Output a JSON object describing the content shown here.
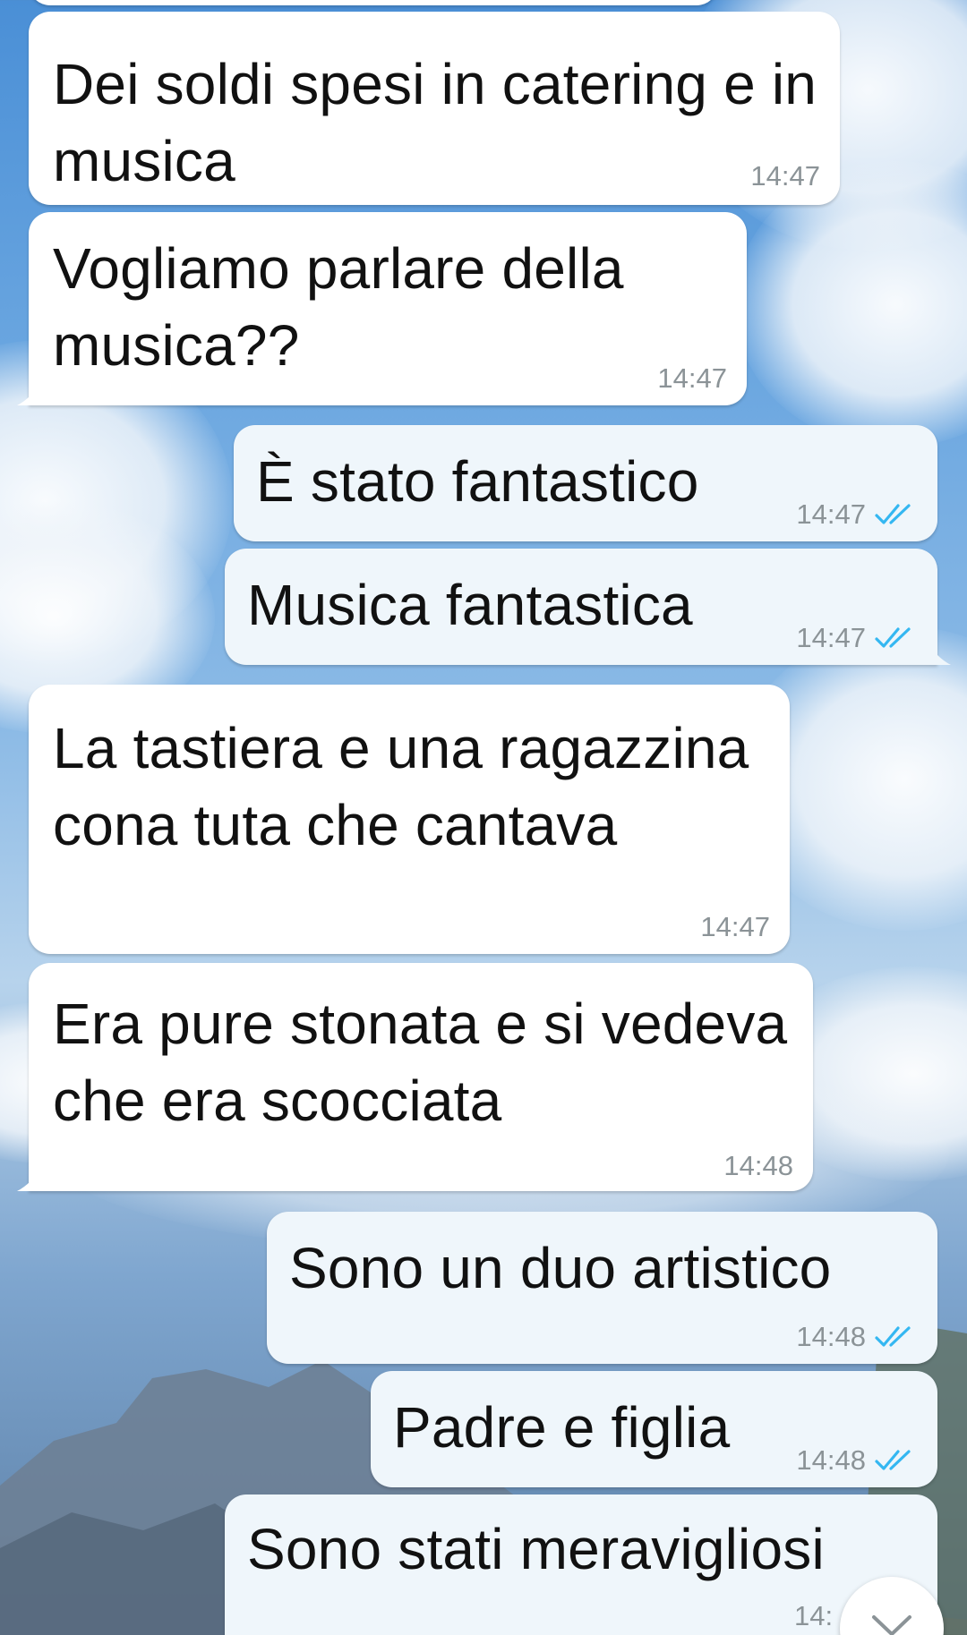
{
  "messages": [
    {
      "direction": "in",
      "text": "Dei soldi spesi in catering e in musica",
      "time": "14:47"
    },
    {
      "direction": "in",
      "text": "Vogliamo parlare della musica??",
      "time": "14:47"
    },
    {
      "direction": "out",
      "text": "È stato fantastico",
      "time": "14:47",
      "status": "read"
    },
    {
      "direction": "out",
      "text": "Musica fantastica",
      "time": "14:47",
      "status": "read"
    },
    {
      "direction": "in",
      "text": "La tastiera e una ragazzina cona tuta che cantava",
      "time": "14:47"
    },
    {
      "direction": "in",
      "text": "Era pure stonata e si vedeva che era scocciata",
      "time": "14:48"
    },
    {
      "direction": "out",
      "text": "Sono un duo artistico",
      "time": "14:48",
      "status": "read"
    },
    {
      "direction": "out",
      "text": "Padre e figlia",
      "time": "14:48",
      "status": "read"
    },
    {
      "direction": "out",
      "text": "Sono stati meravigliosi",
      "time": "14:",
      "status": "read"
    }
  ],
  "icons": {
    "read_receipt": "double-check-icon",
    "scroll_down": "chevron-down-icon"
  },
  "colors": {
    "incoming_bubble": "#ffffff",
    "outgoing_bubble": "#eff6fb",
    "read_check": "#34b7f1",
    "timestamp": "#8b9397"
  }
}
